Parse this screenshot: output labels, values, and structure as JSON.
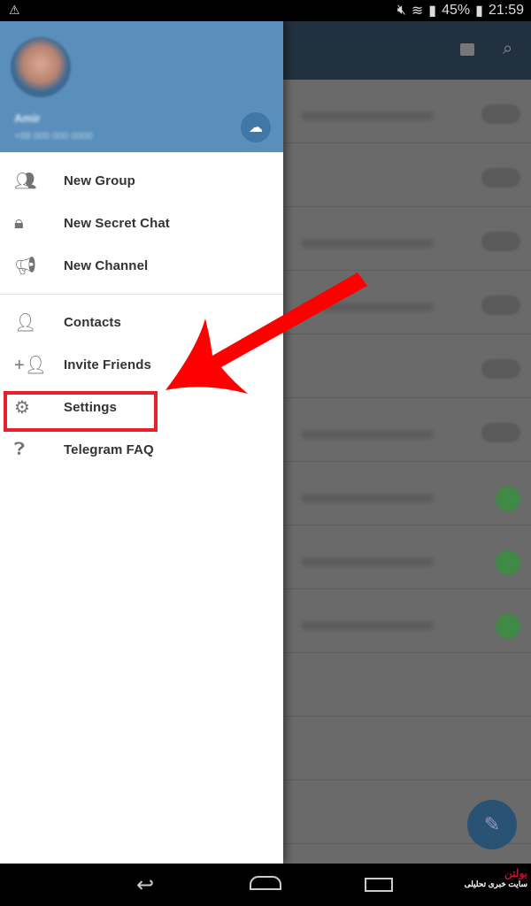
{
  "status_bar": {
    "battery": "45%",
    "time": "21:59"
  },
  "drawer": {
    "user": {
      "name": "Amir",
      "phone": "+98 000 000 0000"
    },
    "menu": [
      {
        "label": "New Group",
        "icon": "group-icon"
      },
      {
        "label": "New Secret Chat",
        "icon": "lock-icon"
      },
      {
        "label": "New Channel",
        "icon": "megaphone-icon"
      },
      {
        "label": "Contacts",
        "icon": "contact-icon"
      },
      {
        "label": "Invite Friends",
        "icon": "add-person-icon"
      },
      {
        "label": "Settings",
        "icon": "gear-icon"
      },
      {
        "label": "Telegram FAQ",
        "icon": "help-icon"
      }
    ]
  },
  "annotation": {
    "highlight": "Settings",
    "color": "#ff0000"
  },
  "colors": {
    "header": "#5a8fbb",
    "appbar": "#22313f",
    "annotation_red": "#ff0000"
  },
  "watermark": {
    "logo": "بولتن",
    "tagline": "سایت خبری تحلیلی"
  }
}
